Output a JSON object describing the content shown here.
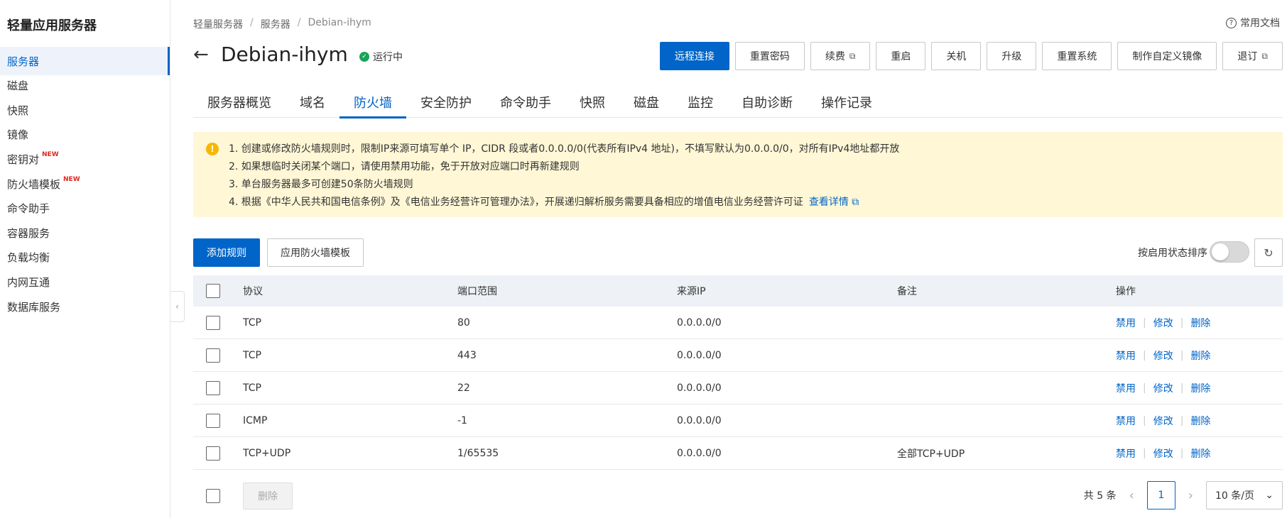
{
  "sidebar": {
    "title": "轻量应用服务器",
    "items": [
      {
        "label": "服务器",
        "active": true
      },
      {
        "label": "磁盘"
      },
      {
        "label": "快照"
      },
      {
        "label": "镜像"
      },
      {
        "label": "密钥对",
        "badge": "NEW"
      },
      {
        "label": "防火墙模板",
        "badge": "NEW"
      },
      {
        "label": "命令助手"
      },
      {
        "label": "容器服务"
      },
      {
        "label": "负载均衡"
      },
      {
        "label": "内网互通"
      },
      {
        "label": "数据库服务"
      }
    ],
    "collapse_icon": "‹"
  },
  "breadcrumb": [
    "轻量服务器",
    "服务器",
    "Debian-ihym"
  ],
  "breadcrumb_sep": "/",
  "help": {
    "icon": "?",
    "label": "常用文档"
  },
  "header": {
    "back_icon": "←",
    "title": "Debian-ihym",
    "status_icon": "✓",
    "status": "运行中",
    "status_color": "#1aa35a"
  },
  "actions": [
    {
      "label": "远程连接",
      "primary": true
    },
    {
      "label": "重置密码"
    },
    {
      "label": "续费",
      "external": true
    },
    {
      "label": "重启"
    },
    {
      "label": "关机"
    },
    {
      "label": "升级"
    },
    {
      "label": "重置系统"
    },
    {
      "label": "制作自定义镜像"
    },
    {
      "label": "退订",
      "external": true
    }
  ],
  "external_icon": "⧉",
  "tabs": [
    "服务器概览",
    "域名",
    "防火墙",
    "安全防护",
    "命令助手",
    "快照",
    "磁盘",
    "监控",
    "自助诊断",
    "操作记录"
  ],
  "active_tab": 2,
  "notice": {
    "icon": "!",
    "lines": [
      "1. 创建或修改防火墙规则时，限制IP来源可填写单个 IP，CIDR 段或者0.0.0.0/0(代表所有IPv4 地址)，不填写默认为0.0.0.0/0，对所有IPv4地址都开放",
      "2. 如果想临时关闭某个端口，请使用禁用功能，免于开放对应端口时再新建规则",
      "3. 单台服务器最多可创建50条防火墙规则",
      "4. 根据《中华人民共和国电信条例》及《电信业务经营许可管理办法》，开展递归解析服务需要具备相应的增值电信业务经营许可证"
    ],
    "link": "查看详情"
  },
  "toolbar": {
    "add_rule": "添加规则",
    "apply_template": "应用防火墙模板",
    "sort_label": "按启用状态排序",
    "refresh_icon": "↻"
  },
  "table": {
    "headers": [
      "协议",
      "端口范围",
      "来源IP",
      "备注",
      "操作"
    ],
    "rows": [
      {
        "protocol": "TCP",
        "port": "80",
        "source": "0.0.0.0/0",
        "note": ""
      },
      {
        "protocol": "TCP",
        "port": "443",
        "source": "0.0.0.0/0",
        "note": ""
      },
      {
        "protocol": "TCP",
        "port": "22",
        "source": "0.0.0.0/0",
        "note": ""
      },
      {
        "protocol": "ICMP",
        "port": "-1",
        "source": "0.0.0.0/0",
        "note": ""
      },
      {
        "protocol": "TCP+UDP",
        "port": "1/65535",
        "source": "0.0.0.0/0",
        "note": "全部TCP+UDP"
      }
    ],
    "ops": [
      "禁用",
      "修改",
      "删除"
    ],
    "op_sep": "|"
  },
  "footer": {
    "delete_label": "删除",
    "total": "共 5 条",
    "prev_icon": "‹",
    "next_icon": "›",
    "page": "1",
    "page_size": "10 条/页",
    "dropdown_icon": "⌄"
  },
  "colors": {
    "primary": "#0064c8",
    "notice_bg": "#fff7d6",
    "warning": "#f5b800"
  }
}
